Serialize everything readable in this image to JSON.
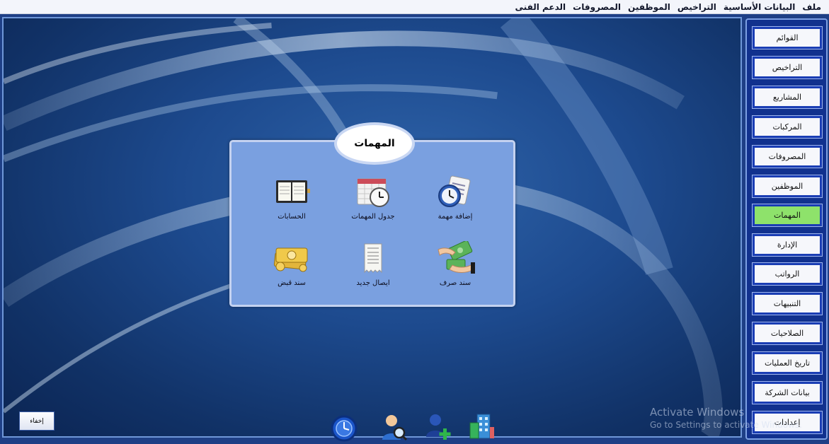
{
  "menu": {
    "items": [
      {
        "label": "ملف"
      },
      {
        "label": "البيانات الأساسية"
      },
      {
        "label": "التراخيص"
      },
      {
        "label": "الموظفين"
      },
      {
        "label": "المصروفات"
      },
      {
        "label": "الدعم الفنى"
      }
    ]
  },
  "sidebar": {
    "items": [
      {
        "label": "القوائم"
      },
      {
        "label": "التراخيص"
      },
      {
        "label": "المشاريع"
      },
      {
        "label": "المركبات"
      },
      {
        "label": "المصروفات"
      },
      {
        "label": "الموظفين"
      },
      {
        "label": "المهمات",
        "active": true
      },
      {
        "label": "الإدارة"
      },
      {
        "label": "الرواتب"
      },
      {
        "label": "التنبيهات"
      },
      {
        "label": "الصلاحيات"
      },
      {
        "label": "تاريخ العمليات"
      },
      {
        "label": "بيانات الشركة"
      },
      {
        "label": "إعدادات"
      }
    ]
  },
  "panel": {
    "title": "المهمات",
    "tiles": [
      {
        "label": "إضافة مهمة",
        "icon": "calendar-clock-icon"
      },
      {
        "label": "جدول المهمات",
        "icon": "schedule-clock-icon"
      },
      {
        "label": "الحسابات",
        "icon": "ledger-book-icon"
      },
      {
        "label": "سند صرف",
        "icon": "money-hands-icon"
      },
      {
        "label": "ايصال جديد",
        "icon": "receipt-icon"
      },
      {
        "label": "سند قبض",
        "icon": "gold-cash-icon"
      }
    ]
  },
  "hide_button": {
    "label": "إخفاء"
  },
  "dock": {
    "icons": [
      "clock-icon",
      "user-search-icon",
      "add-user-icon",
      "building-icon"
    ]
  },
  "watermark": {
    "title": "Activate Windows",
    "subtitle": "Go to Settings to activate Windows."
  },
  "colors": {
    "desktop": "#1d4a8e",
    "sidebar": "#11318e",
    "panel": "#7aa0e0",
    "active_button": "#8ee26b",
    "button_border": "#1a3db4"
  }
}
